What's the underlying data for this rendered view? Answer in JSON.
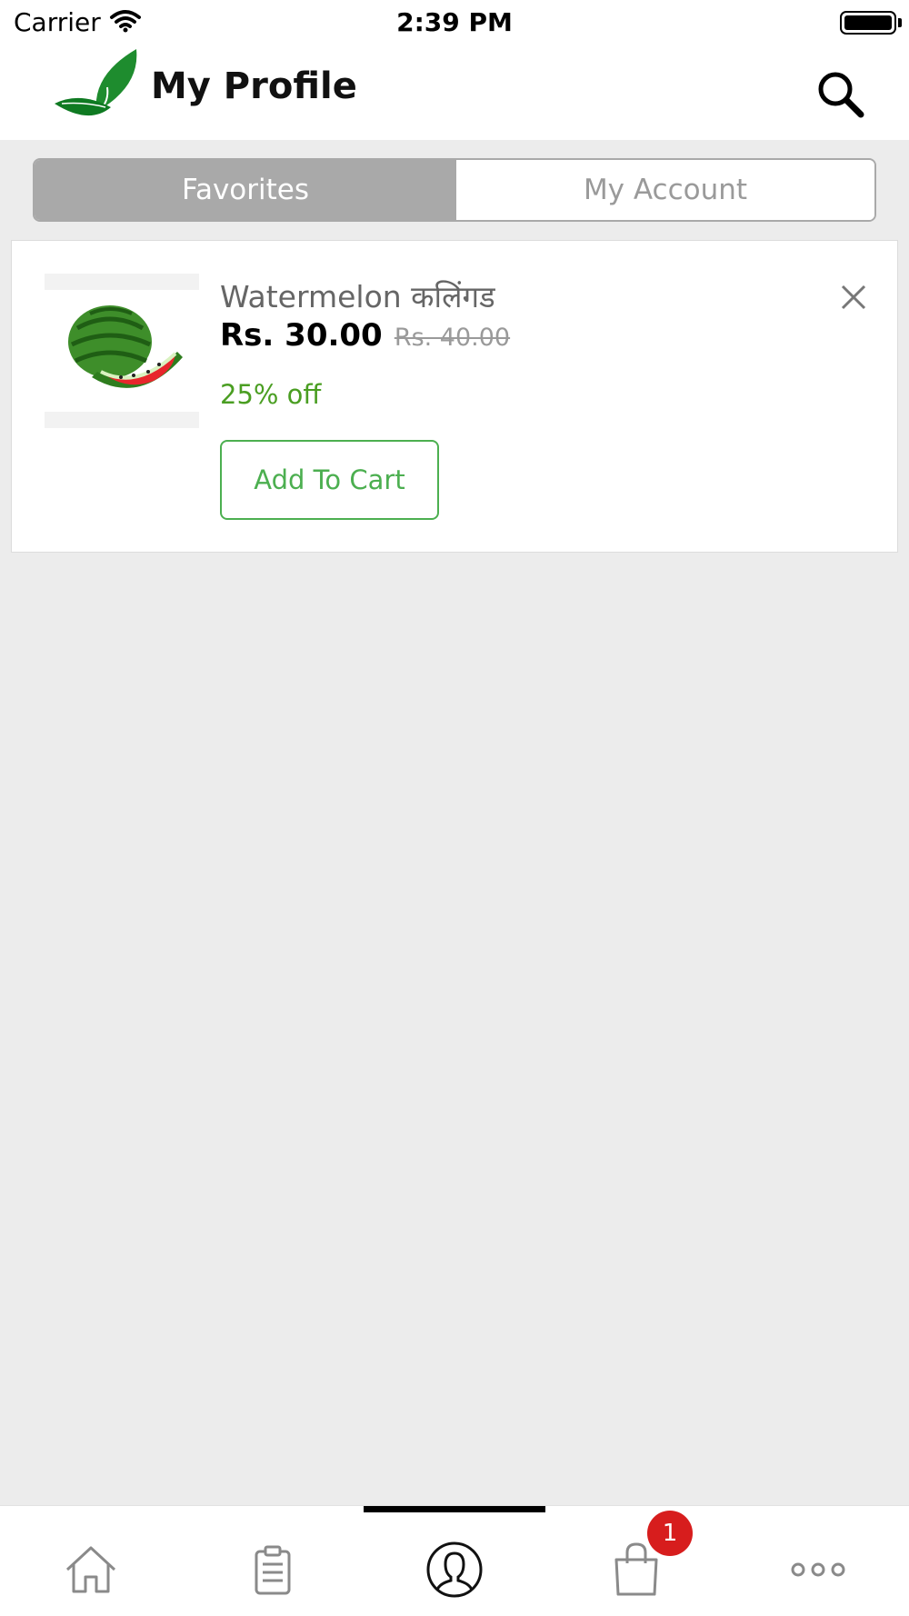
{
  "status_bar": {
    "carrier": "Carrier",
    "time": "2:39 PM"
  },
  "header": {
    "title": "My Profile",
    "logo_icon": "green-leaves-logo",
    "search_icon": "search-icon"
  },
  "tabs": [
    {
      "label": "Favorites",
      "active": true
    },
    {
      "label": "My Account",
      "active": false
    }
  ],
  "favorites": [
    {
      "name": "Watermelon  कलिंगड",
      "price": "Rs. 30.00",
      "old_price": "Rs. 40.00",
      "discount": "25% off",
      "add_label": "Add To Cart",
      "image_icon": "watermelon-image"
    }
  ],
  "tab_bar": {
    "items": [
      "home-icon",
      "orders-icon",
      "profile-icon",
      "cart-icon",
      "more-icon"
    ],
    "active": "profile-icon",
    "cart_badge": "1"
  },
  "colors": {
    "accent_green": "#4caf50",
    "discount_green": "#4a9e22",
    "segment_active": "#a9a9a9",
    "badge_red": "#d71d1d",
    "background": "#ececec"
  }
}
